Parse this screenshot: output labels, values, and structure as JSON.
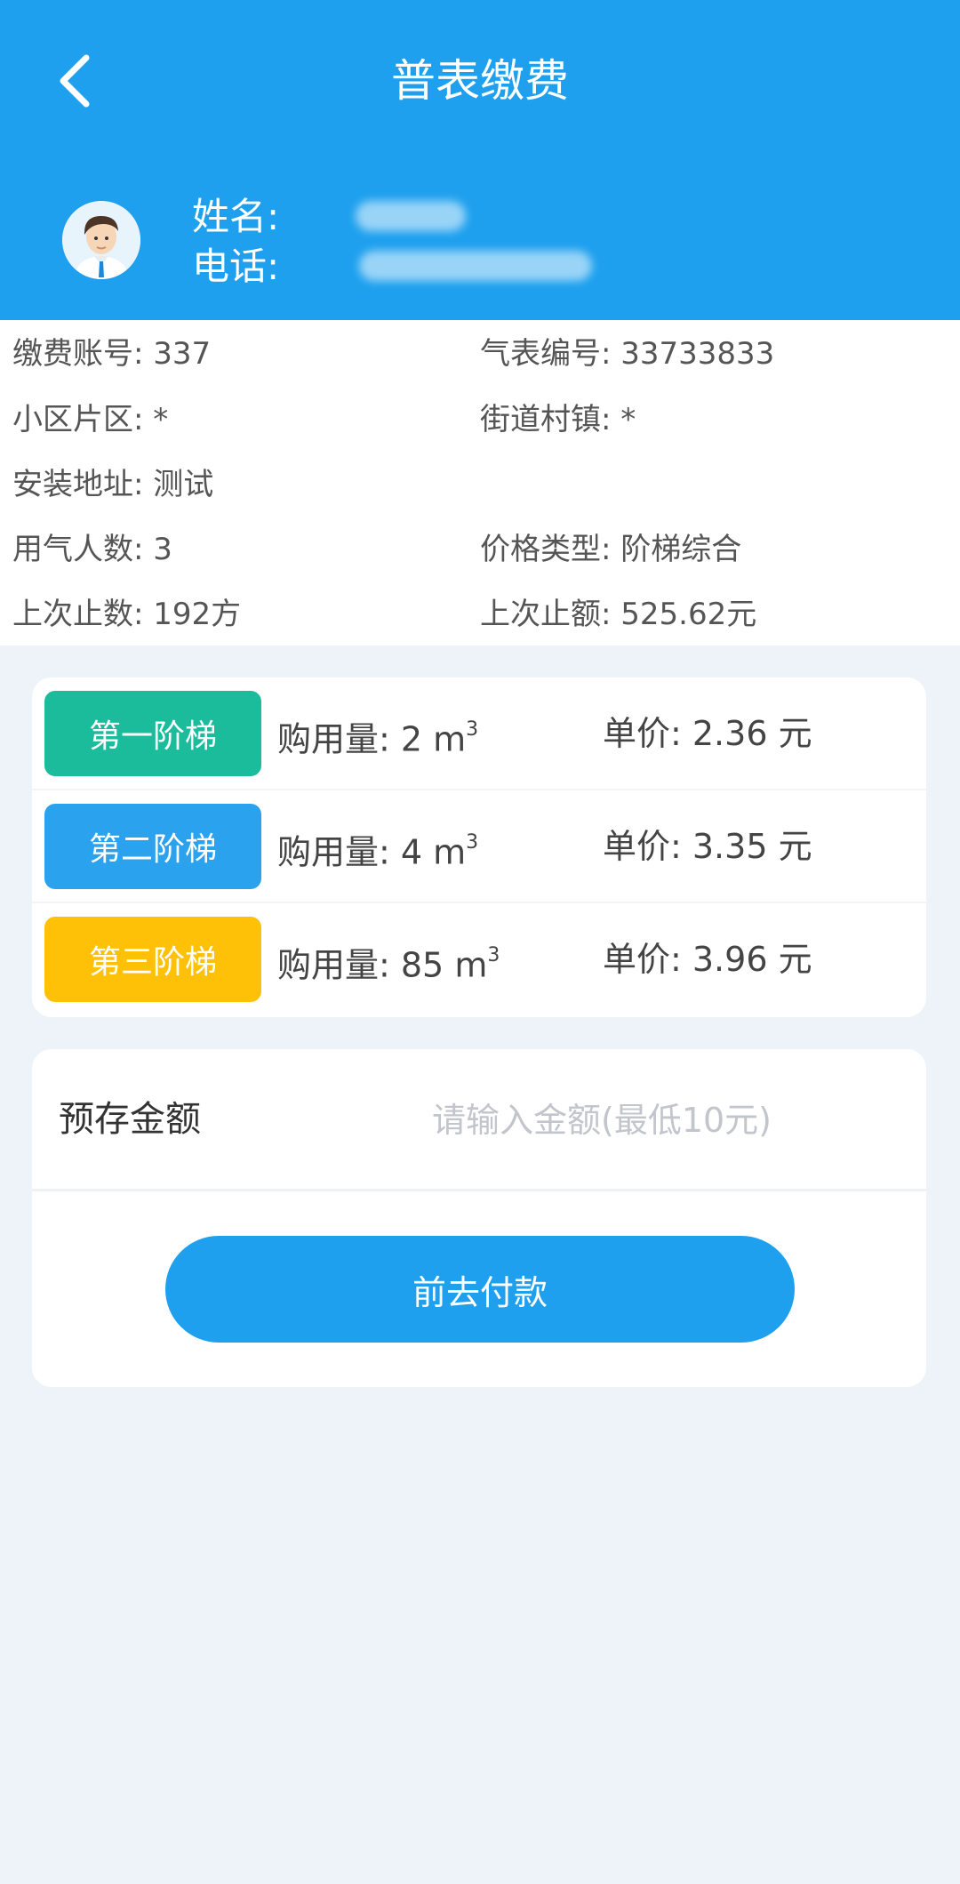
{
  "header": {
    "title": "普表缴费",
    "back_icon": "chevron-left-icon"
  },
  "user": {
    "avatar_icon": "user-avatar-icon",
    "name_label": "姓名:",
    "phone_label": "电话:"
  },
  "info": {
    "account": "缴费账号: 337",
    "meter": "气表编号: 33733833",
    "area": "小区片区: *",
    "street": "街道村镇: *",
    "address": "安装地址: 测试",
    "users": "用气人数: 3",
    "price_type": "价格类型: 阶梯综合",
    "last_reading": "上次止数: 192方",
    "last_amount": "上次止额: 525.62元"
  },
  "tiers": [
    {
      "name": "第一阶梯",
      "qty_label": "购用量: 2 m",
      "unit_sup": "3",
      "price": "单价: 2.36 元",
      "color": "#1abc9c"
    },
    {
      "name": "第二阶梯",
      "qty_label": "购用量: 4 m",
      "unit_sup": "3",
      "price": "单价: 3.35 元",
      "color": "#2aa2ee"
    },
    {
      "name": "第三阶梯",
      "qty_label": "购用量: 85 m",
      "unit_sup": "3",
      "price": "单价: 3.96 元",
      "color": "#ffc107"
    }
  ],
  "payment": {
    "amount_label": "预存金额",
    "amount_value": "",
    "amount_placeholder": "请输入金额(最低10元)",
    "pay_button": "前去付款"
  },
  "colors": {
    "primary": "#1ea0ee",
    "background": "#eef3fa"
  }
}
